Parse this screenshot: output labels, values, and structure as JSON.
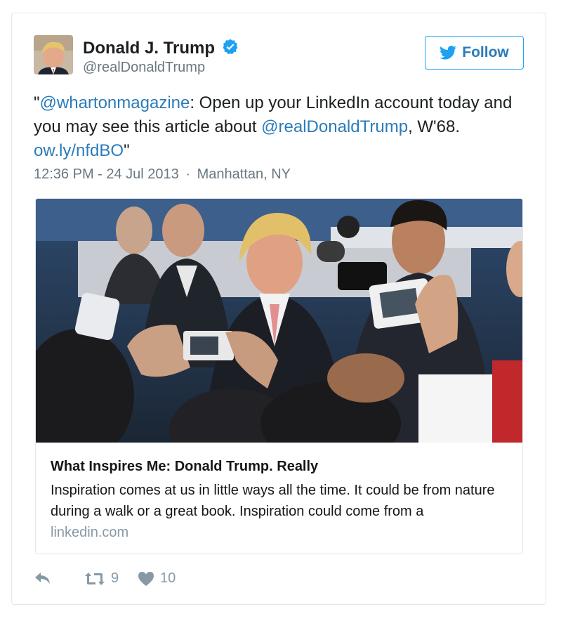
{
  "author": {
    "name": "Donald J. Trump",
    "handle": "@realDonaldTrump"
  },
  "follow": {
    "label": "Follow"
  },
  "tweet": {
    "quote_open": "\"",
    "mention1": "@whartonmagazine",
    "text1": ": Open up your LinkedIn account today and you may see this article about ",
    "mention2": "@realDonaldTrump",
    "text2": ", W'68. ",
    "link": "ow.ly/nfdBO",
    "quote_close": "\""
  },
  "meta": {
    "time": "12:36 PM - 24 Jul 2013",
    "separator": "·",
    "location": "Manhattan, NY"
  },
  "card": {
    "title": "What Inspires Me: Donald Trump. Really",
    "description": "Inspiration comes at us in little ways all the time. It could be from nature during a walk or a great book. Inspiration could come from a",
    "domain": "linkedin.com"
  },
  "actions": {
    "retweets": "9",
    "likes": "10"
  },
  "colors": {
    "link": "#2b7bb9",
    "verified": "#1da1f2",
    "muted": "#697882",
    "action": "#8899a6"
  },
  "icons": [
    "verified-badge-icon",
    "twitter-bird-icon",
    "reply-icon",
    "retweet-icon",
    "heart-icon"
  ]
}
